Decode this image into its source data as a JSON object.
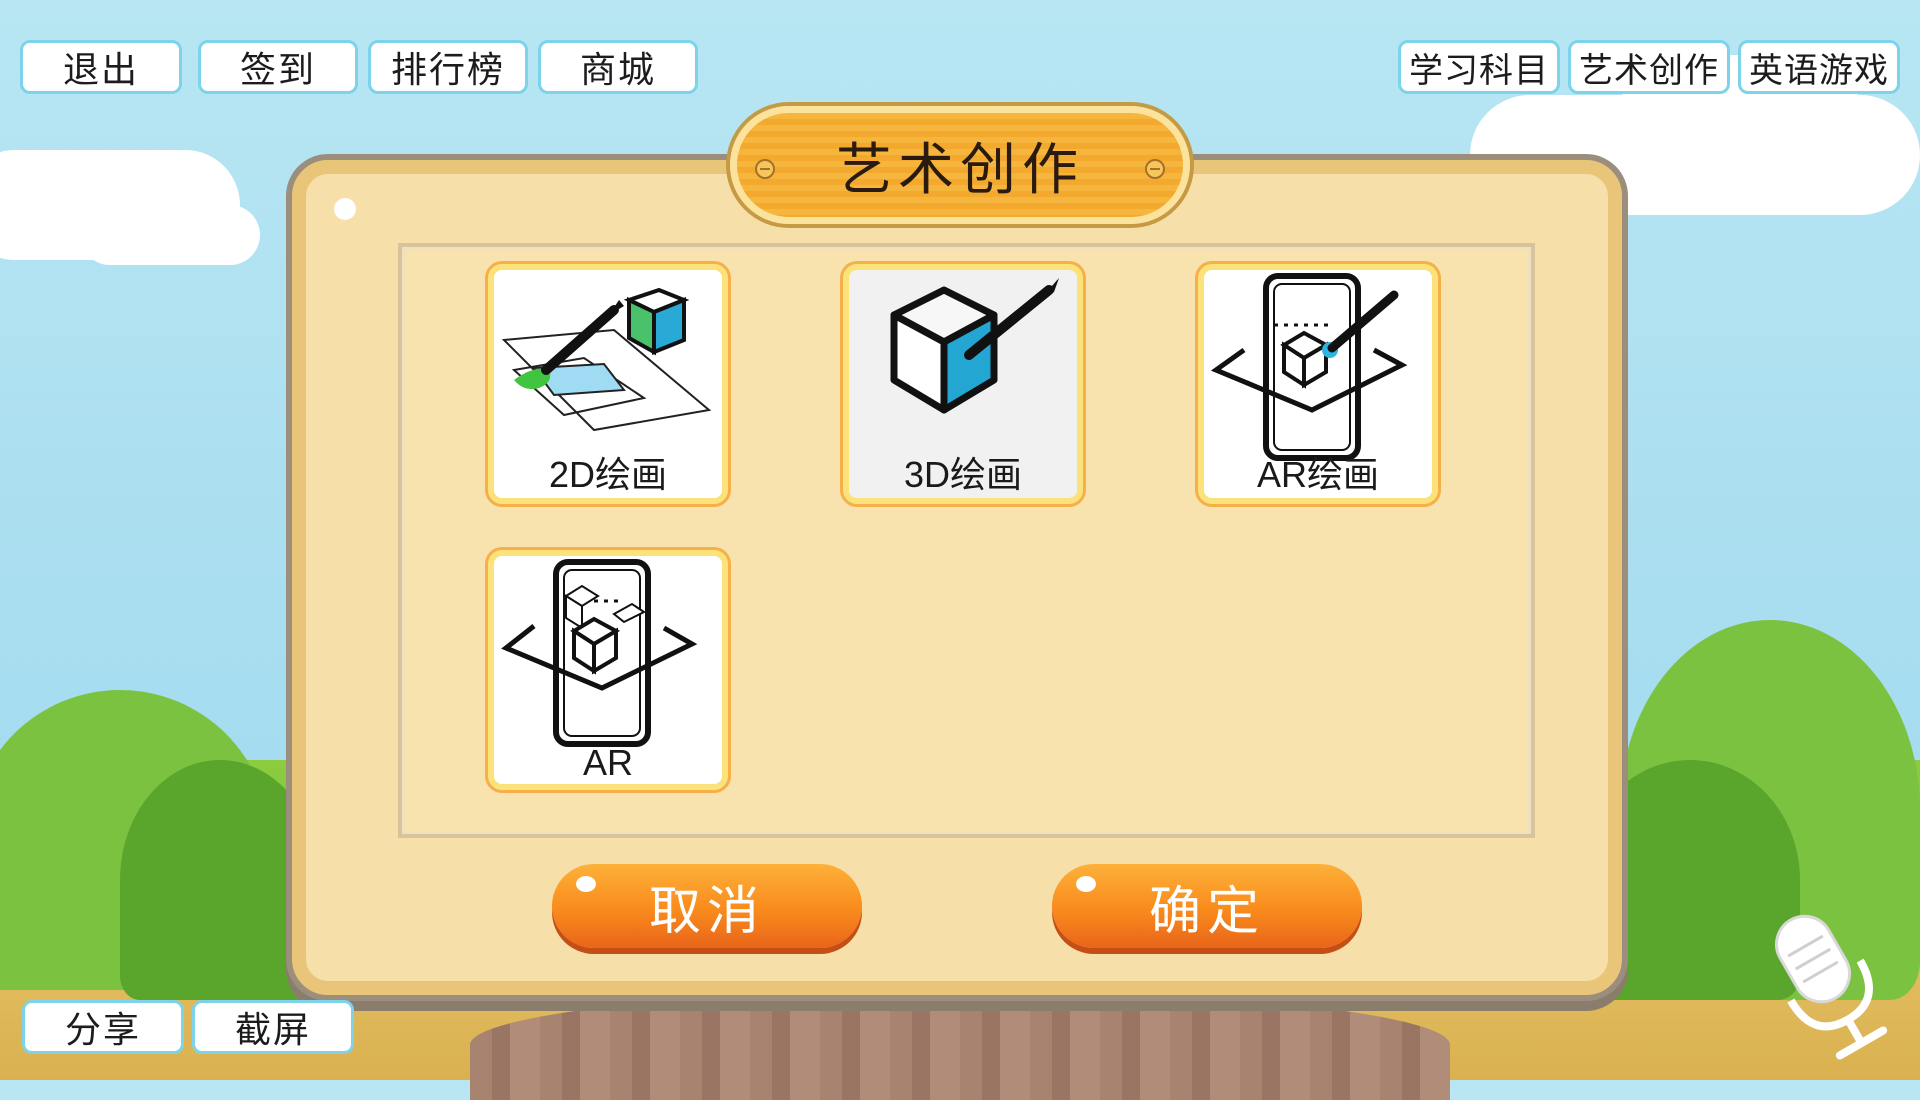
{
  "top_left_buttons": [
    {
      "label": "退出"
    },
    {
      "label": "签到"
    },
    {
      "label": "排行榜"
    },
    {
      "label": "商城"
    }
  ],
  "top_right_tabs": [
    {
      "label": "学习科目"
    },
    {
      "label": "艺术创作"
    },
    {
      "label": "英语游戏"
    }
  ],
  "dialog": {
    "title": "艺术创作",
    "cards": [
      {
        "label": "2D绘画",
        "icon": "2d-painting-icon"
      },
      {
        "label": "3D绘画",
        "icon": "3d-painting-icon"
      },
      {
        "label": "AR绘画",
        "icon": "ar-painting-icon"
      },
      {
        "label": "AR",
        "icon": "ar-icon"
      }
    ],
    "cancel_label": "取消",
    "confirm_label": "确定"
  },
  "bottom_left_buttons": [
    {
      "label": "分享"
    },
    {
      "label": "截屏"
    }
  ],
  "colors": {
    "button_border": "#7cd3ea",
    "panel_bg": "#f6dfa8",
    "action_orange": "#f98a1c",
    "title_plate": "#f6b53d"
  }
}
